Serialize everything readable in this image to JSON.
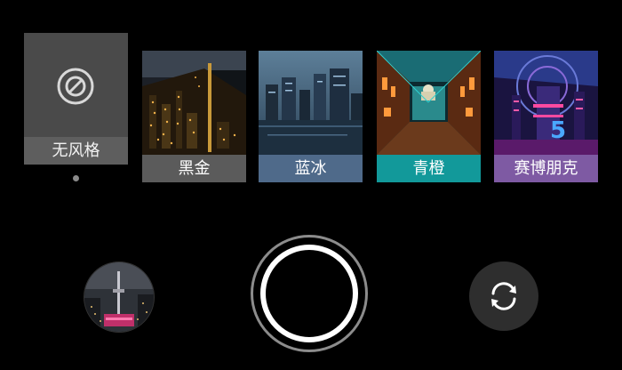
{
  "filters": {
    "none": {
      "label": "无风格",
      "icon": "no-style-icon",
      "selected": true
    },
    "items": [
      {
        "label": "黑金",
        "label_color": "#5b5b5b"
      },
      {
        "label": "蓝冰",
        "label_color": "#4f6a8a"
      },
      {
        "label": "青橙",
        "label_color": "#12999a"
      },
      {
        "label": "赛博朋克",
        "label_color": "#7e5aa3"
      }
    ]
  },
  "controls": {
    "gallery_icon": "gallery-thumbnail",
    "shutter_icon": "shutter-ring",
    "switch_camera_icon": "rotate-camera-icon"
  },
  "colors": {
    "background": "#000000",
    "selected_tile": "#4a4a4a"
  }
}
